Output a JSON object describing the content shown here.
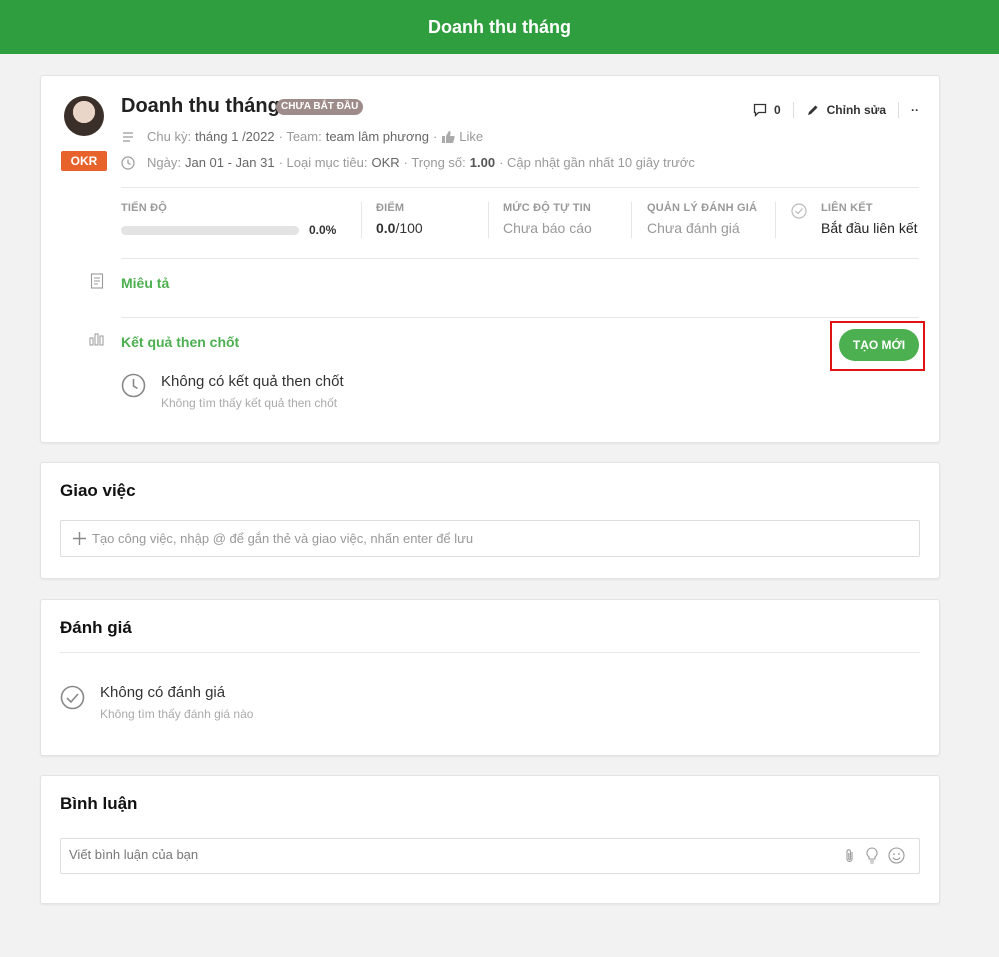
{
  "header": {
    "title": "Doanh thu tháng"
  },
  "objective": {
    "title": "Doanh thu tháng",
    "status": "CHƯA BẮT ĐẦU",
    "badge": "OKR",
    "cycle_label": "Chu kỳ:",
    "cycle_value": "tháng 1 /2022",
    "team_label": "· Team:",
    "team_value": "team lâm phương",
    "like_label": "Like",
    "date_label": "Ngày:",
    "date_value": "Jan 01 - Jan 31",
    "type_label": "· Loại mục tiêu:",
    "type_value": "OKR",
    "weight_label": "· Trọng số:",
    "weight_value": "1.00",
    "updated": "· Cập nhật gần nhất 10 giây trước",
    "comment_count": "0",
    "edit_label": "Chỉnh sửa",
    "more_label": "··"
  },
  "stats": {
    "progress_label": "TIẾN ĐỘ",
    "progress_value": "0.0%",
    "progress_fraction": 0,
    "score_label": "ĐIỂM",
    "score_value": "0.0",
    "score_max": "/100",
    "confidence_label": "MỨC ĐỘ TỰ TIN",
    "confidence_value": "Chưa báo cáo",
    "review_label": "QUẢN LÝ ĐÁNH GIÁ",
    "review_value": "Chưa đánh giá",
    "link_label": "LIÊN KẾT",
    "link_value": "Bắt đầu liên kết"
  },
  "description": {
    "label": "Miêu tả"
  },
  "key_results": {
    "label": "Kết quả then chốt",
    "create_button": "TẠO MỚI",
    "empty_title": "Không có kết quả then chốt",
    "empty_sub": "Không tìm thấy kết quả then chốt"
  },
  "tasks": {
    "title": "Giao việc",
    "placeholder": "Tạo công việc, nhập @ để gắn thẻ và giao việc, nhấn enter để lưu"
  },
  "reviews": {
    "title": "Đánh giá",
    "empty_title": "Không có đánh giá",
    "empty_sub": "Không tìm thấy đánh giá nào"
  },
  "comments": {
    "title": "Bình luận",
    "placeholder": "Viết bình luận của bạn"
  },
  "colors": {
    "brand": "#2f9e3e",
    "accent": "#4caf50",
    "okr_badge": "#e8622c",
    "highlight": "#e01212"
  }
}
